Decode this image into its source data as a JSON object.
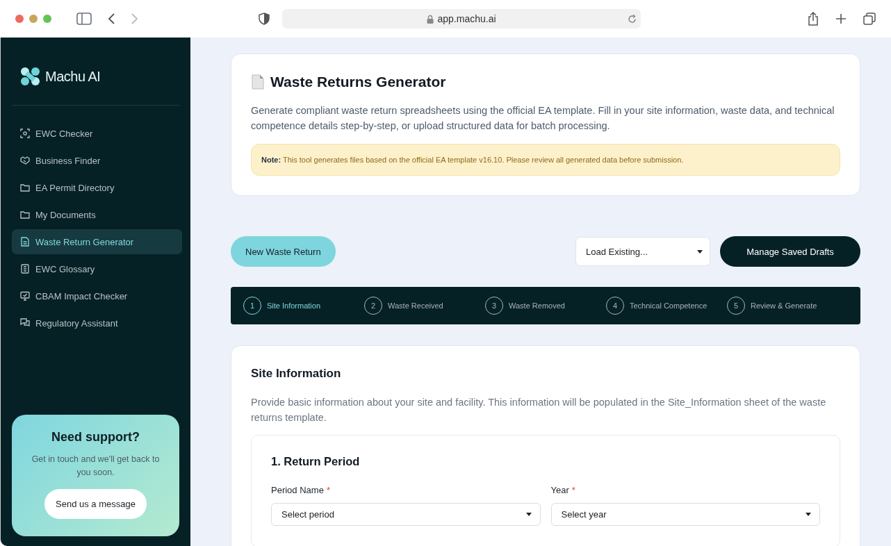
{
  "browser": {
    "url": "app.machu.ai"
  },
  "sidebar": {
    "brand": "Machu AI",
    "items": [
      {
        "label": "EWC Checker",
        "selected": false
      },
      {
        "label": "Business Finder",
        "selected": false
      },
      {
        "label": "EA Permit Directory",
        "selected": false
      },
      {
        "label": "My Documents",
        "selected": false
      },
      {
        "label": "Waste Return Generator",
        "selected": true
      },
      {
        "label": "EWC Glossary",
        "selected": false
      },
      {
        "label": "CBAM Impact Checker",
        "selected": false
      },
      {
        "label": "Regulatory Assistant",
        "selected": false
      }
    ],
    "support": {
      "title": "Need support?",
      "text": "Get in touch and we'll get back to you soon.",
      "button": "Send us a message"
    }
  },
  "header": {
    "title": "Waste Returns Generator",
    "description": "Generate compliant waste return spreadsheets using the official EA template. Fill in your site information, waste data, and technical competence details step-by-step, or upload structured data for batch processing.",
    "note": "**Note:** This tool generates files based on the official EA template v16.10. Please review all generated data before submission."
  },
  "toolbar": {
    "new_button": "New Waste Return",
    "load_select": {
      "placeholder": "Load Existing..."
    },
    "drafts_button": "Manage Saved Drafts"
  },
  "steps": [
    {
      "number": "1",
      "label": "Site Information",
      "selected": true
    },
    {
      "number": "2",
      "label": "Waste Received",
      "selected": false
    },
    {
      "number": "3",
      "label": "Waste Removed",
      "selected": false
    },
    {
      "number": "4",
      "label": "Technical Competence",
      "selected": false
    },
    {
      "number": "5",
      "label": "Review & Generate",
      "selected": false
    }
  ],
  "section": {
    "title": "Site Information",
    "description": "Provide basic information about your site and facility. This information will be populated in the Site_Information sheet of the waste returns template.",
    "subsection": {
      "title": "1. Return Period",
      "fields": [
        {
          "label": "Period Name",
          "required_mark": "*",
          "placeholder": "Select period"
        },
        {
          "label": "Year",
          "required_mark": "*",
          "placeholder": "Select year"
        }
      ]
    }
  }
}
